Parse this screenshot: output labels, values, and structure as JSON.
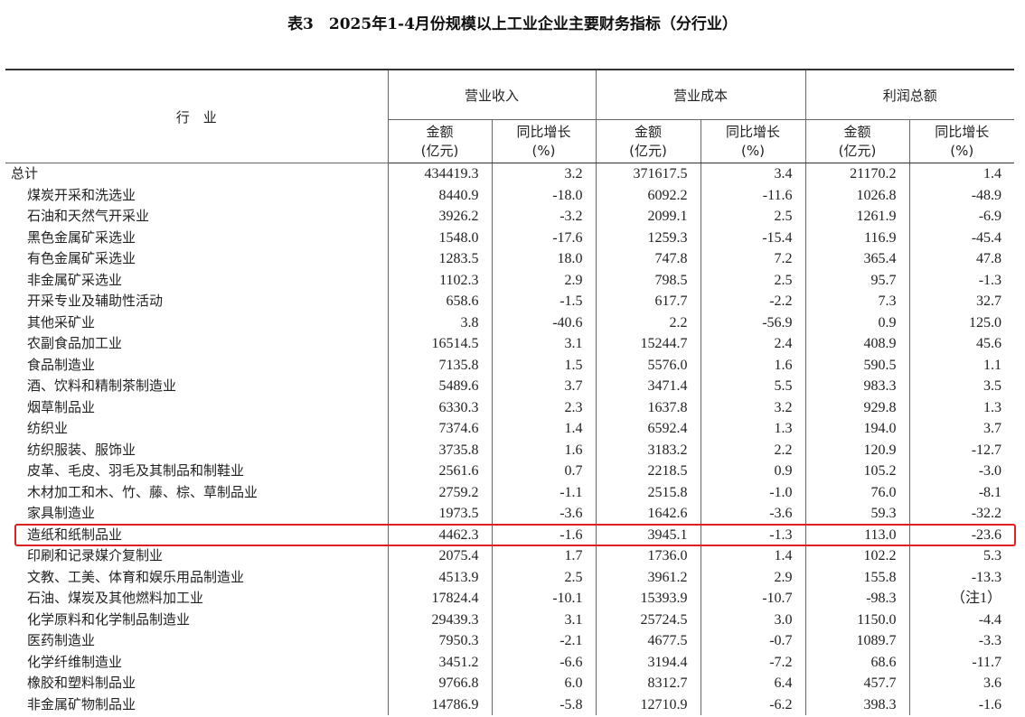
{
  "title": "表3　2025年1-4月份规模以上工业企业主要财务指标（分行业）",
  "header": {
    "industry": "行　业",
    "groups": [
      "营业收入",
      "营业成本",
      "利润总额"
    ],
    "amount": [
      "金额",
      "(亿元)"
    ],
    "growth": [
      "同比增长",
      "(%)"
    ]
  },
  "rows": [
    {
      "name": "总计",
      "indent": false,
      "cells": [
        "434419.3",
        "3.2",
        "371617.5",
        "3.4",
        "21170.2",
        "1.4"
      ]
    },
    {
      "name": "煤炭开采和洗选业",
      "indent": true,
      "cells": [
        "8440.9",
        "-18.0",
        "6092.2",
        "-11.6",
        "1026.8",
        "-48.9"
      ]
    },
    {
      "name": "石油和天然气开采业",
      "indent": true,
      "cells": [
        "3926.2",
        "-3.2",
        "2099.1",
        "2.5",
        "1261.9",
        "-6.9"
      ]
    },
    {
      "name": "黑色金属矿采选业",
      "indent": true,
      "cells": [
        "1548.0",
        "-17.6",
        "1259.3",
        "-15.4",
        "116.9",
        "-45.4"
      ]
    },
    {
      "name": "有色金属矿采选业",
      "indent": true,
      "cells": [
        "1283.5",
        "18.0",
        "747.8",
        "7.2",
        "365.4",
        "47.8"
      ]
    },
    {
      "name": "非金属矿采选业",
      "indent": true,
      "cells": [
        "1102.3",
        "2.9",
        "798.5",
        "2.5",
        "95.7",
        "-1.3"
      ]
    },
    {
      "name": "开采专业及辅助性活动",
      "indent": true,
      "cells": [
        "658.6",
        "-1.5",
        "617.7",
        "-2.2",
        "7.3",
        "32.7"
      ]
    },
    {
      "name": "其他采矿业",
      "indent": true,
      "cells": [
        "3.8",
        "-40.6",
        "2.2",
        "-56.9",
        "0.9",
        "125.0"
      ]
    },
    {
      "name": "农副食品加工业",
      "indent": true,
      "cells": [
        "16514.5",
        "3.1",
        "15244.7",
        "2.4",
        "408.9",
        "45.6"
      ]
    },
    {
      "name": "食品制造业",
      "indent": true,
      "cells": [
        "7135.8",
        "1.5",
        "5576.0",
        "1.6",
        "590.5",
        "1.1"
      ]
    },
    {
      "name": "酒、饮料和精制茶制造业",
      "indent": true,
      "cells": [
        "5489.6",
        "3.7",
        "3471.4",
        "5.5",
        "983.3",
        "3.5"
      ]
    },
    {
      "name": "烟草制品业",
      "indent": true,
      "cells": [
        "6330.3",
        "2.3",
        "1637.8",
        "3.2",
        "929.8",
        "1.3"
      ]
    },
    {
      "name": "纺织业",
      "indent": true,
      "cells": [
        "7374.6",
        "1.4",
        "6592.4",
        "1.3",
        "194.0",
        "3.7"
      ]
    },
    {
      "name": "纺织服装、服饰业",
      "indent": true,
      "cells": [
        "3735.8",
        "1.6",
        "3183.2",
        "2.2",
        "120.9",
        "-12.7"
      ]
    },
    {
      "name": "皮革、毛皮、羽毛及其制品和制鞋业",
      "indent": true,
      "cells": [
        "2561.6",
        "0.7",
        "2218.5",
        "0.9",
        "105.2",
        "-3.0"
      ]
    },
    {
      "name": "木材加工和木、竹、藤、棕、草制品业",
      "indent": true,
      "cells": [
        "2759.2",
        "-1.1",
        "2515.8",
        "-1.0",
        "76.0",
        "-8.1"
      ]
    },
    {
      "name": "家具制造业",
      "indent": true,
      "cells": [
        "1973.5",
        "-3.6",
        "1642.6",
        "-3.6",
        "59.3",
        "-32.2"
      ]
    },
    {
      "name": "造纸和纸制品业",
      "indent": true,
      "cells": [
        "4462.3",
        "-1.6",
        "3945.1",
        "-1.3",
        "113.0",
        "-23.6"
      ]
    },
    {
      "name": "印刷和记录媒介复制业",
      "indent": true,
      "cells": [
        "2075.4",
        "1.7",
        "1736.0",
        "1.4",
        "102.2",
        "5.3"
      ]
    },
    {
      "name": "文教、工美、体育和娱乐用品制造业",
      "indent": true,
      "cells": [
        "4513.9",
        "2.5",
        "3961.2",
        "2.9",
        "155.8",
        "-13.3"
      ]
    },
    {
      "name": "石油、煤炭及其他燃料加工业",
      "indent": true,
      "cells": [
        "17824.4",
        "-10.1",
        "15393.9",
        "-10.7",
        "-98.3",
        "（注1）"
      ]
    },
    {
      "name": "化学原料和化学制品制造业",
      "indent": true,
      "cells": [
        "29439.3",
        "3.1",
        "25724.5",
        "3.0",
        "1150.0",
        "-4.4"
      ]
    },
    {
      "name": "医药制造业",
      "indent": true,
      "cells": [
        "7950.3",
        "-2.1",
        "4677.5",
        "-0.7",
        "1089.7",
        "-3.3"
      ]
    },
    {
      "name": "化学纤维制造业",
      "indent": true,
      "cells": [
        "3451.2",
        "-6.6",
        "3194.4",
        "-7.2",
        "68.6",
        "-11.7"
      ]
    },
    {
      "name": "橡胶和塑料制品业",
      "indent": true,
      "cells": [
        "9766.8",
        "6.0",
        "8312.7",
        "6.4",
        "457.7",
        "3.6"
      ]
    },
    {
      "name": "非金属矿物制品业",
      "indent": true,
      "cells": [
        "14786.9",
        "-5.8",
        "12710.9",
        "-6.2",
        "398.3",
        "-1.6"
      ]
    }
  ],
  "highlighted_row": "造纸和纸制品业",
  "colors": {
    "highlight": "#e02020",
    "rule": "#333333"
  }
}
